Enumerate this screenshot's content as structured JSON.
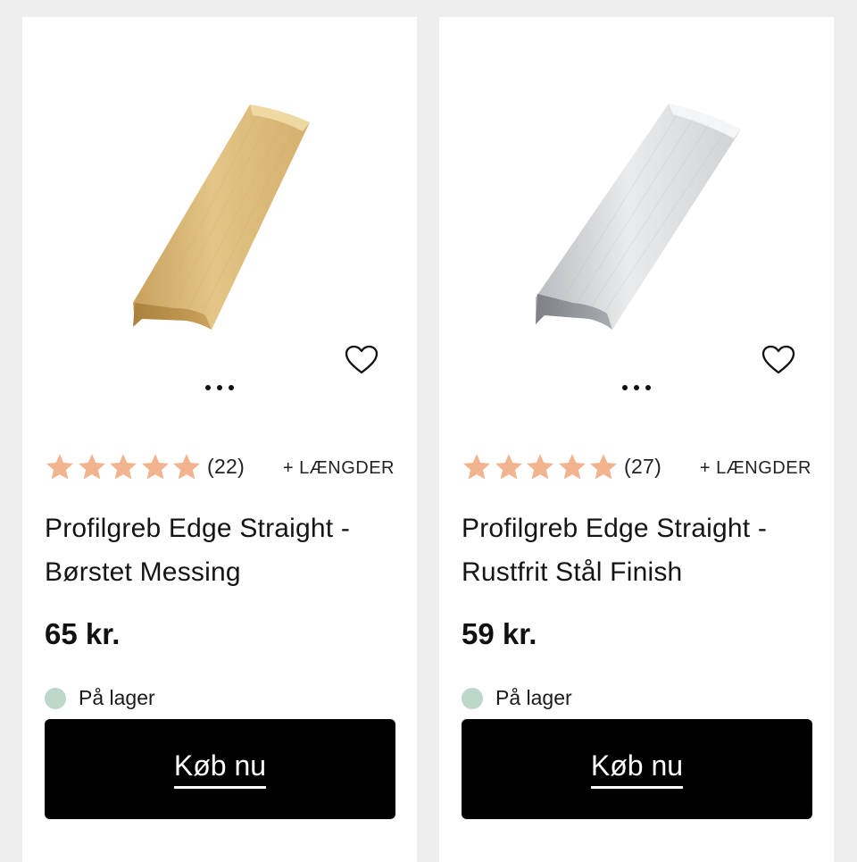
{
  "colors": {
    "page_background": "#eeeeee",
    "card_background": "#ffffff",
    "star": "#f2b48f",
    "in_stock_dot": "#bdd7c9",
    "button_background": "#000000",
    "button_text": "#ffffff"
  },
  "products": [
    {
      "image_icon": "brushed-brass-edge-handle-image",
      "rating_stars": 5,
      "review_count": "(22)",
      "variants_label": "+ LÆNGDER",
      "title_line1": "Profilgreb Edge Straight -",
      "title_line2": "Børstet Messing",
      "price": "65 kr.",
      "stock_status": "På lager",
      "buy_label": "Køb nu"
    },
    {
      "image_icon": "stainless-steel-edge-handle-image",
      "rating_stars": 5,
      "review_count": "(27)",
      "variants_label": "+ LÆNGDER",
      "title_line1": "Profilgreb Edge Straight -",
      "title_line2": "Rustfrit Stål Finish",
      "price": "59 kr.",
      "stock_status": "På lager",
      "buy_label": "Køb nu"
    }
  ],
  "icons": {
    "wishlist": "heart-outline-icon",
    "more": "more-dots-icon",
    "rating": "star-icon",
    "stock": "status-dot-icon"
  }
}
